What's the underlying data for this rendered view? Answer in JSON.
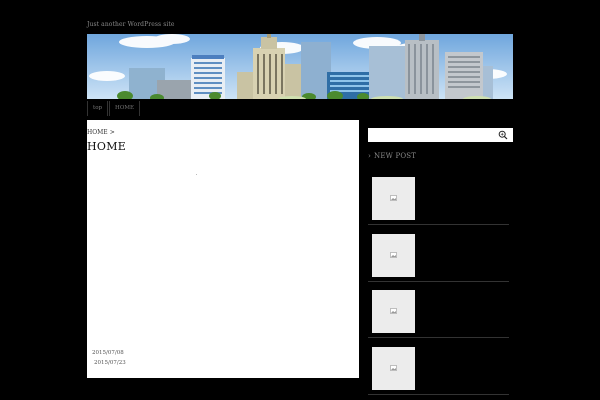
{
  "site": {
    "tagline": "Just another WordPress site"
  },
  "nav": {
    "items": [
      {
        "label": "top"
      },
      {
        "label": "HOME"
      }
    ]
  },
  "breadcrumb": {
    "home": "HOME",
    "separator": ">"
  },
  "page": {
    "title": "HOME"
  },
  "dates": [
    "2015/07/08",
    "2015/07/23"
  ],
  "sidebar": {
    "search": {
      "value": "",
      "placeholder": ""
    },
    "widget_title": "NEW POST",
    "posts_count_visible": 4
  },
  "colors": {
    "background": "#000000",
    "content": "#ffffff",
    "sky": "#9cc7ee"
  },
  "icons": {
    "search": "magnifier-icon",
    "widget": "chevron-right-icon",
    "thumbnail": "image-placeholder-icon"
  }
}
